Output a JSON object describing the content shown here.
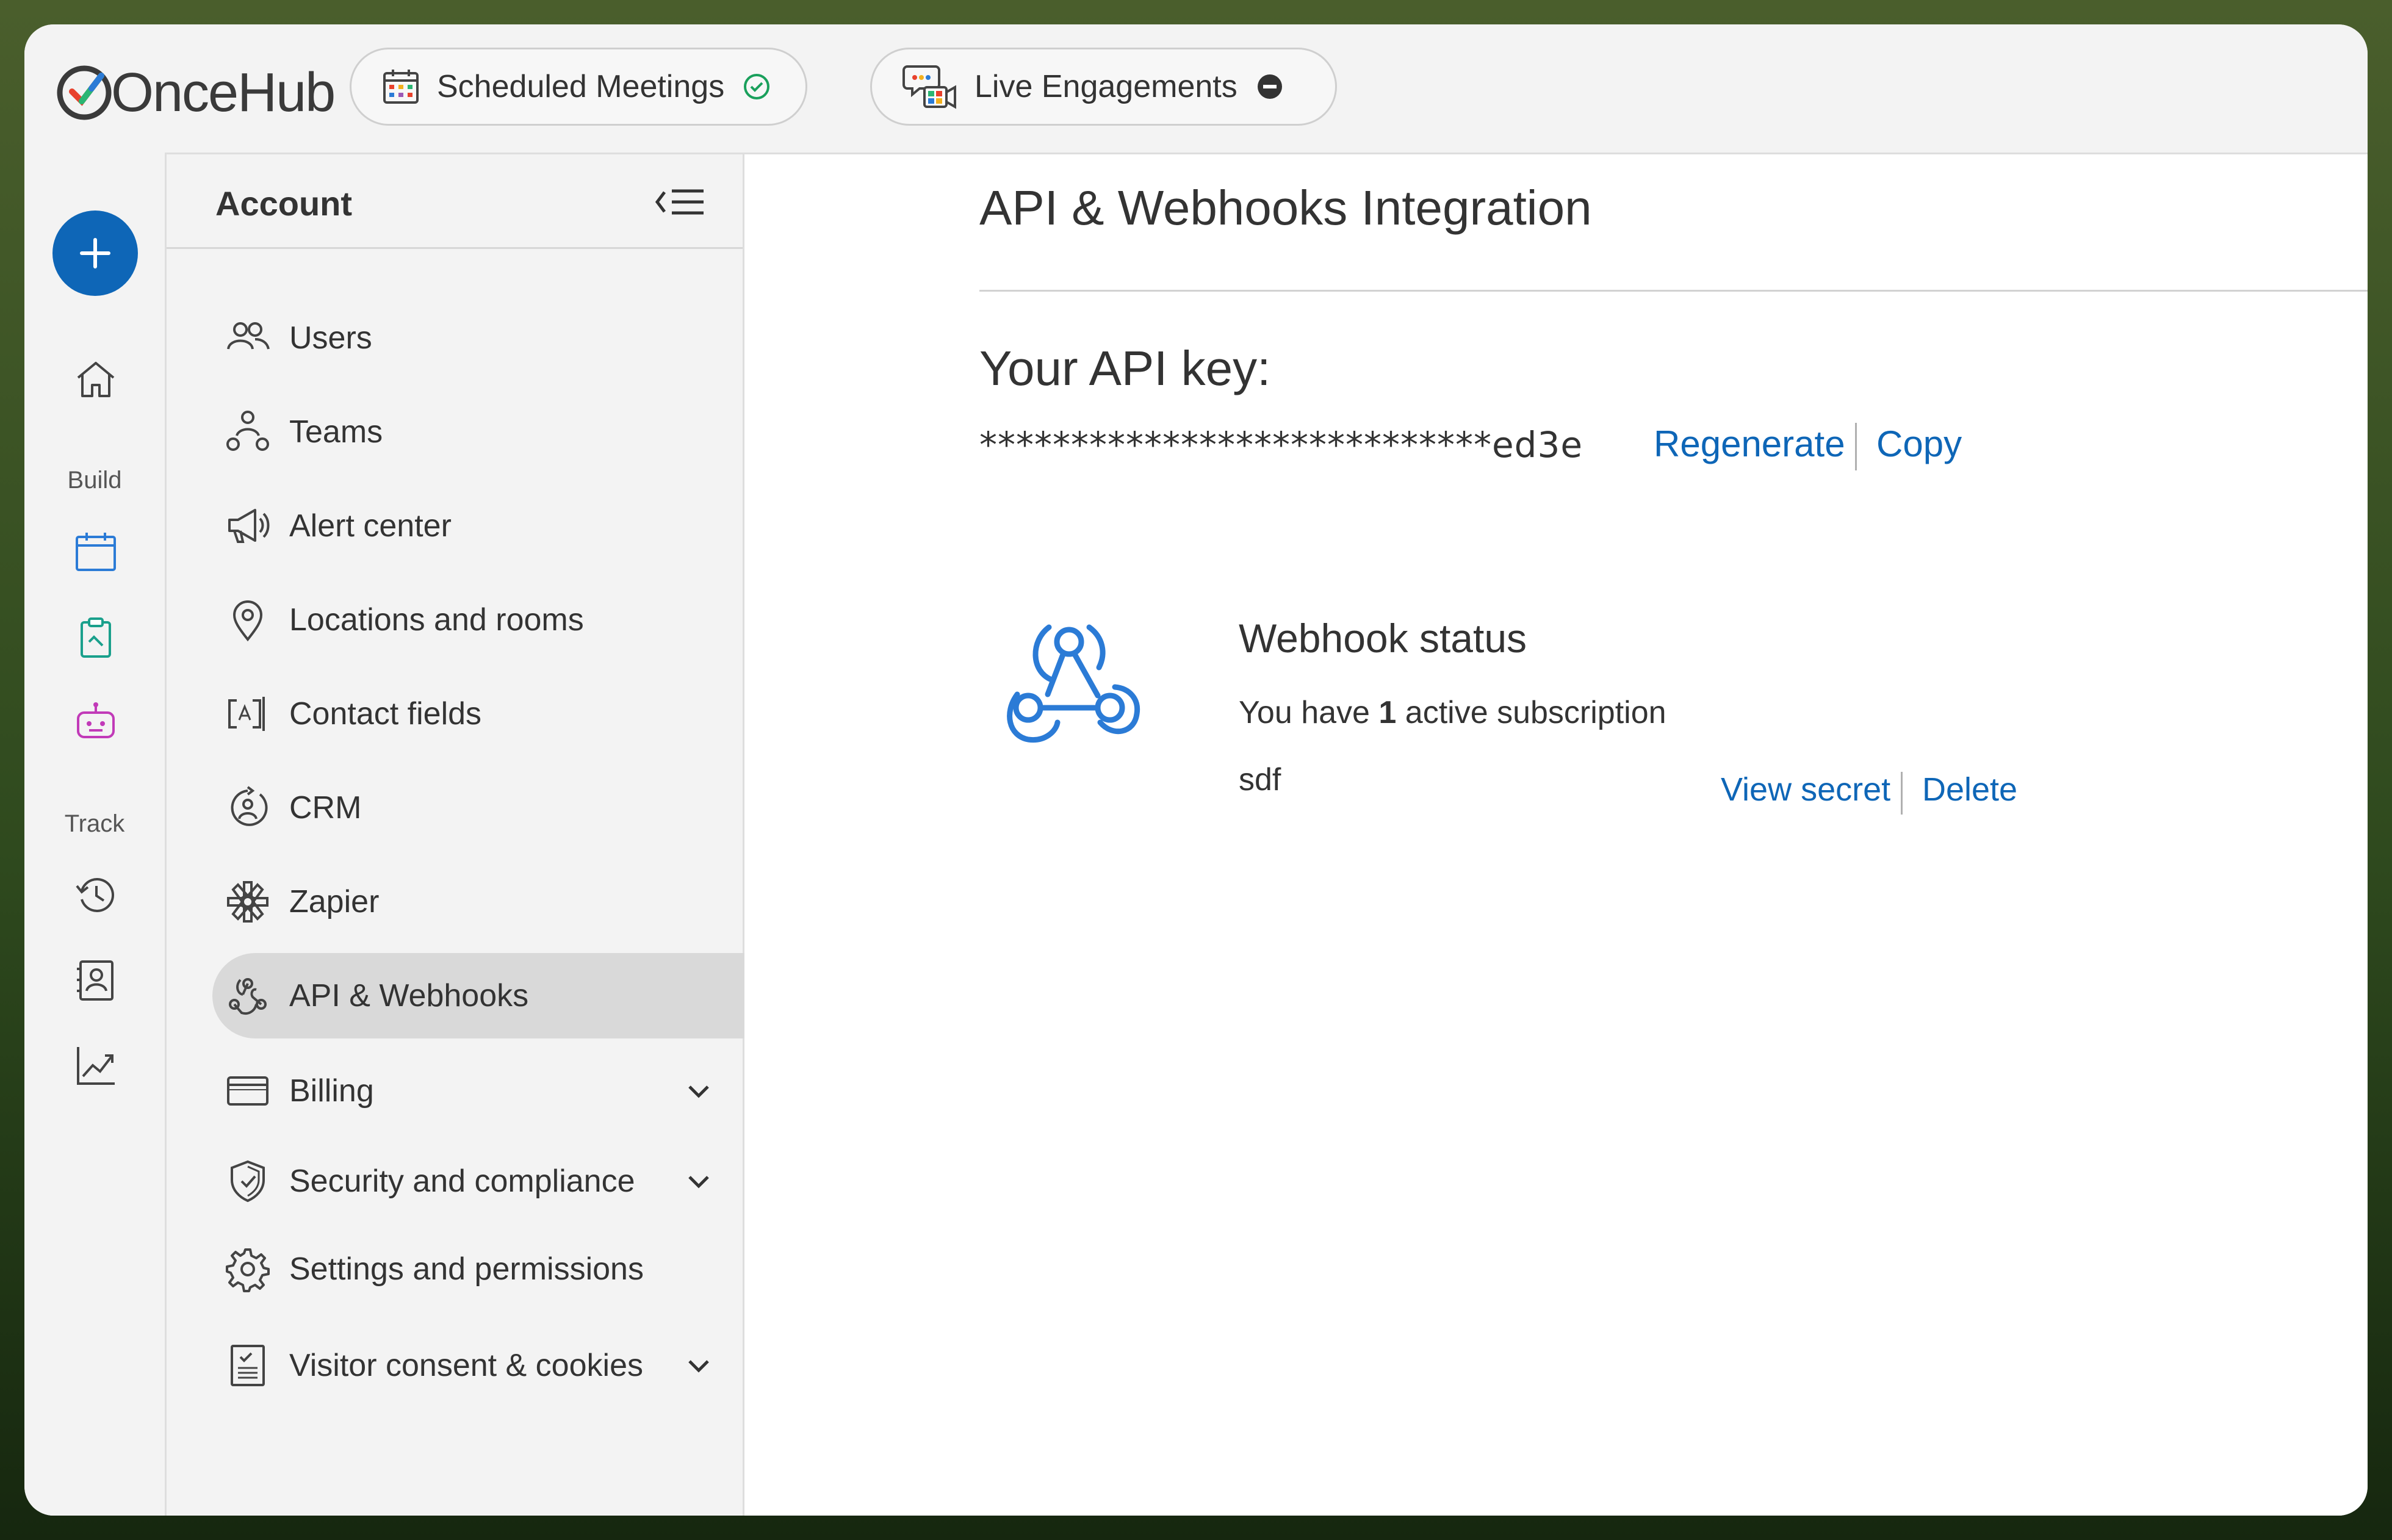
{
  "brand": {
    "name": "OnceHub",
    "accent": "#0e66b7"
  },
  "topbar": {
    "tabs": [
      {
        "label": "Scheduled Meetings",
        "status": "active"
      },
      {
        "label": "Live Engagements",
        "status": "inactive"
      }
    ]
  },
  "rail": {
    "sections": [
      {
        "label": "Build"
      },
      {
        "label": "Track"
      }
    ]
  },
  "sidebar": {
    "title": "Account",
    "items": [
      {
        "label": "Users",
        "icon": "users-icon"
      },
      {
        "label": "Teams",
        "icon": "teams-icon"
      },
      {
        "label": "Alert center",
        "icon": "megaphone-icon"
      },
      {
        "label": "Locations and rooms",
        "icon": "location-pin-icon"
      },
      {
        "label": "Contact fields",
        "icon": "text-field-icon"
      },
      {
        "label": "CRM",
        "icon": "crm-icon"
      },
      {
        "label": "Zapier",
        "icon": "zapier-icon"
      },
      {
        "label": "API & Webhooks",
        "icon": "webhook-icon",
        "active": true
      },
      {
        "label": "Billing",
        "icon": "credit-card-icon",
        "expandable": true
      },
      {
        "label": "Security and compliance",
        "icon": "shield-icon",
        "expandable": true
      },
      {
        "label": "Settings and permissions",
        "icon": "gear-icon"
      },
      {
        "label": "Visitor consent & cookies",
        "icon": "document-check-icon",
        "expandable": true
      }
    ]
  },
  "main": {
    "title": "API & Webhooks Integration",
    "api_key_label": "Your API key:",
    "api_key_value": "****************************ed3e",
    "regenerate_label": "Regenerate",
    "copy_label": "Copy",
    "webhook": {
      "title": "Webhook status",
      "sub_prefix": "You have ",
      "count": "1",
      "sub_suffix": " active subscription",
      "name": "sdf",
      "view_secret_label": "View secret",
      "delete_label": "Delete"
    }
  }
}
